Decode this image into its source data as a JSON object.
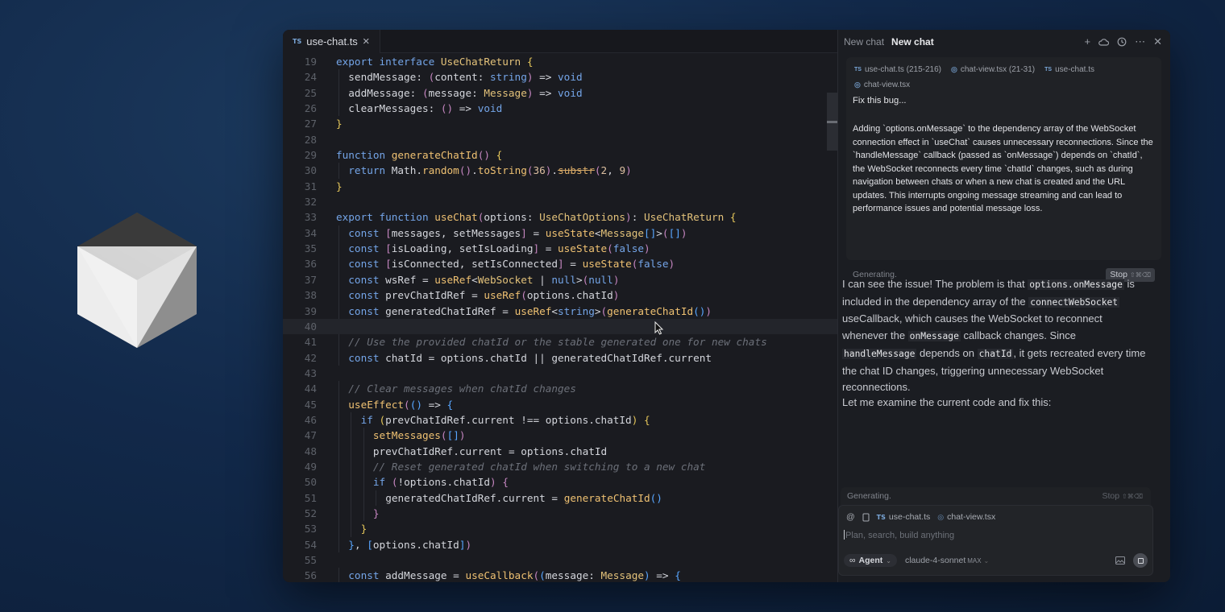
{
  "editor": {
    "tab": {
      "badge": "TS",
      "filename": "use-chat.ts",
      "close": "×"
    },
    "active_line": "40",
    "lines": [
      {
        "n": "19",
        "indent": 0,
        "segs": [
          [
            "k",
            "export interface "
          ],
          [
            "ty",
            "UseChatReturn "
          ],
          [
            "br",
            "{"
          ]
        ]
      },
      {
        "n": "24",
        "indent": 1,
        "segs": [
          [
            "pl",
            "sendMessage: "
          ],
          [
            "br2",
            "("
          ],
          [
            "pl",
            "content: "
          ],
          [
            "k",
            "string"
          ],
          [
            "br2",
            ")"
          ],
          [
            "pl",
            " => "
          ],
          [
            "k",
            "void"
          ]
        ]
      },
      {
        "n": "25",
        "indent": 1,
        "segs": [
          [
            "pl",
            "addMessage: "
          ],
          [
            "br2",
            "("
          ],
          [
            "pl",
            "message: "
          ],
          [
            "ty",
            "Message"
          ],
          [
            "br2",
            ")"
          ],
          [
            "pl",
            " => "
          ],
          [
            "k",
            "void"
          ]
        ]
      },
      {
        "n": "26",
        "indent": 1,
        "segs": [
          [
            "pl",
            "clearMessages: "
          ],
          [
            "br2",
            "()"
          ],
          [
            "pl",
            " => "
          ],
          [
            "k",
            "void"
          ]
        ]
      },
      {
        "n": "27",
        "indent": 0,
        "segs": [
          [
            "br",
            "}"
          ]
        ]
      },
      {
        "n": "28",
        "indent": 0,
        "segs": []
      },
      {
        "n": "29",
        "indent": 0,
        "segs": [
          [
            "k",
            "function "
          ],
          [
            "fn",
            "generateChatId"
          ],
          [
            "br2",
            "()"
          ],
          [
            "pl",
            " "
          ],
          [
            "br",
            "{"
          ]
        ]
      },
      {
        "n": "30",
        "indent": 1,
        "segs": [
          [
            "k",
            "return "
          ],
          [
            "pl",
            "Math."
          ],
          [
            "fn",
            "random"
          ],
          [
            "br2",
            "()"
          ],
          [
            "pl",
            "."
          ],
          [
            "fn",
            "toString"
          ],
          [
            "br2",
            "("
          ],
          [
            "num",
            "36"
          ],
          [
            "br2",
            ")"
          ],
          [
            "pl",
            "."
          ],
          [
            "strike",
            "substr"
          ],
          [
            "br2",
            "("
          ],
          [
            "num",
            "2"
          ],
          [
            "pl",
            ", "
          ],
          [
            "num",
            "9"
          ],
          [
            "br2",
            ")"
          ]
        ]
      },
      {
        "n": "31",
        "indent": 0,
        "segs": [
          [
            "br",
            "}"
          ]
        ]
      },
      {
        "n": "32",
        "indent": 0,
        "segs": []
      },
      {
        "n": "33",
        "indent": 0,
        "segs": [
          [
            "k",
            "export function "
          ],
          [
            "fn",
            "useChat"
          ],
          [
            "br2",
            "("
          ],
          [
            "pl",
            "options: "
          ],
          [
            "ty",
            "UseChatOptions"
          ],
          [
            "br2",
            ")"
          ],
          [
            "pl",
            ": "
          ],
          [
            "ty",
            "UseChatReturn "
          ],
          [
            "br",
            "{"
          ]
        ]
      },
      {
        "n": "34",
        "indent": 1,
        "segs": [
          [
            "k",
            "const "
          ],
          [
            "br2",
            "["
          ],
          [
            "pl",
            "messages, setMessages"
          ],
          [
            "br2",
            "]"
          ],
          [
            "pl",
            " = "
          ],
          [
            "fn",
            "useState"
          ],
          [
            "pl",
            "<"
          ],
          [
            "ty",
            "Message"
          ],
          [
            "br3",
            "[]"
          ],
          [
            "pl",
            ">"
          ],
          [
            "br2",
            "("
          ],
          [
            "br3",
            "[]"
          ],
          [
            "br2",
            ")"
          ]
        ]
      },
      {
        "n": "35",
        "indent": 1,
        "segs": [
          [
            "k",
            "const "
          ],
          [
            "br2",
            "["
          ],
          [
            "pl",
            "isLoading, setIsLoading"
          ],
          [
            "br2",
            "]"
          ],
          [
            "pl",
            " = "
          ],
          [
            "fn",
            "useState"
          ],
          [
            "br2",
            "("
          ],
          [
            "k",
            "false"
          ],
          [
            "br2",
            ")"
          ]
        ]
      },
      {
        "n": "36",
        "indent": 1,
        "segs": [
          [
            "k",
            "const "
          ],
          [
            "br2",
            "["
          ],
          [
            "pl",
            "isConnected, setIsConnected"
          ],
          [
            "br2",
            "]"
          ],
          [
            "pl",
            " = "
          ],
          [
            "fn",
            "useState"
          ],
          [
            "br2",
            "("
          ],
          [
            "k",
            "false"
          ],
          [
            "br2",
            ")"
          ]
        ]
      },
      {
        "n": "37",
        "indent": 1,
        "segs": [
          [
            "k",
            "const "
          ],
          [
            "pl",
            "wsRef = "
          ],
          [
            "fn",
            "useRef"
          ],
          [
            "pl",
            "<"
          ],
          [
            "ty",
            "WebSocket"
          ],
          [
            "pl",
            " | "
          ],
          [
            "k",
            "null"
          ],
          [
            "pl",
            ">"
          ],
          [
            "br2",
            "("
          ],
          [
            "k",
            "null"
          ],
          [
            "br2",
            ")"
          ]
        ]
      },
      {
        "n": "38",
        "indent": 1,
        "segs": [
          [
            "k",
            "const "
          ],
          [
            "pl",
            "prevChatIdRef = "
          ],
          [
            "fn",
            "useRef"
          ],
          [
            "br2",
            "("
          ],
          [
            "pl",
            "options.chatId"
          ],
          [
            "br2",
            ")"
          ]
        ]
      },
      {
        "n": "39",
        "indent": 1,
        "segs": [
          [
            "k",
            "const "
          ],
          [
            "pl",
            "generatedChatIdRef = "
          ],
          [
            "fn",
            "useRef"
          ],
          [
            "pl",
            "<"
          ],
          [
            "k",
            "string"
          ],
          [
            "pl",
            ">"
          ],
          [
            "br2",
            "("
          ],
          [
            "fn",
            "generateChatId"
          ],
          [
            "br3",
            "()"
          ],
          [
            "br2",
            ")"
          ]
        ]
      },
      {
        "n": "40",
        "indent": 0,
        "segs": []
      },
      {
        "n": "41",
        "indent": 1,
        "segs": [
          [
            "cm",
            "// Use the provided chatId or the stable generated one for new chats"
          ]
        ]
      },
      {
        "n": "42",
        "indent": 1,
        "segs": [
          [
            "k",
            "const "
          ],
          [
            "pl",
            "chatId = options.chatId || generatedChatIdRef.current"
          ]
        ]
      },
      {
        "n": "43",
        "indent": 0,
        "segs": []
      },
      {
        "n": "44",
        "indent": 1,
        "segs": [
          [
            "cm",
            "// Clear messages when chatId changes"
          ]
        ]
      },
      {
        "n": "45",
        "indent": 1,
        "segs": [
          [
            "fn",
            "useEffect"
          ],
          [
            "br2",
            "("
          ],
          [
            "br3",
            "()"
          ],
          [
            "pl",
            " => "
          ],
          [
            "br3",
            "{"
          ]
        ]
      },
      {
        "n": "46",
        "indent": 2,
        "segs": [
          [
            "k",
            "if "
          ],
          [
            "br",
            "("
          ],
          [
            "pl",
            "prevChatIdRef.current !== options.chatId"
          ],
          [
            "br",
            ")"
          ],
          [
            "pl",
            " "
          ],
          [
            "br",
            "{"
          ]
        ]
      },
      {
        "n": "47",
        "indent": 3,
        "segs": [
          [
            "fn",
            "setMessages"
          ],
          [
            "br2",
            "("
          ],
          [
            "br3",
            "[]"
          ],
          [
            "br2",
            ")"
          ]
        ]
      },
      {
        "n": "48",
        "indent": 3,
        "segs": [
          [
            "pl",
            "prevChatIdRef.current = options.chatId"
          ]
        ]
      },
      {
        "n": "49",
        "indent": 3,
        "segs": [
          [
            "cm",
            "// Reset generated chatId when switching to a new chat"
          ]
        ]
      },
      {
        "n": "50",
        "indent": 3,
        "segs": [
          [
            "k",
            "if "
          ],
          [
            "br2",
            "("
          ],
          [
            "pl",
            "!options.chatId"
          ],
          [
            "br2",
            ")"
          ],
          [
            "pl",
            " "
          ],
          [
            "br2",
            "{"
          ]
        ]
      },
      {
        "n": "51",
        "indent": 4,
        "segs": [
          [
            "pl",
            "generatedChatIdRef.current = "
          ],
          [
            "fn",
            "generateChatId"
          ],
          [
            "br3",
            "()"
          ]
        ]
      },
      {
        "n": "52",
        "indent": 3,
        "segs": [
          [
            "br2",
            "}"
          ]
        ]
      },
      {
        "n": "53",
        "indent": 2,
        "segs": [
          [
            "br",
            "}"
          ]
        ]
      },
      {
        "n": "54",
        "indent": 1,
        "segs": [
          [
            "br3",
            "}"
          ],
          [
            "pl",
            ", "
          ],
          [
            "br3",
            "["
          ],
          [
            "pl",
            "options.chatId"
          ],
          [
            "br3",
            "]"
          ],
          [
            "br2",
            ")"
          ]
        ]
      },
      {
        "n": "55",
        "indent": 0,
        "segs": []
      },
      {
        "n": "56",
        "indent": 1,
        "segs": [
          [
            "k",
            "const "
          ],
          [
            "pl",
            "addMessage = "
          ],
          [
            "fn",
            "useCallback"
          ],
          [
            "br2",
            "("
          ],
          [
            "br3",
            "("
          ],
          [
            "pl",
            "message: "
          ],
          [
            "ty",
            "Message"
          ],
          [
            "br3",
            ")"
          ],
          [
            "pl",
            " => "
          ],
          [
            "br3",
            "{"
          ]
        ]
      }
    ]
  },
  "chat": {
    "tabs": [
      "New chat",
      "New chat"
    ],
    "header_icons": [
      "plus-icon",
      "cloud-icon",
      "history-icon",
      "more-icon",
      "close-icon"
    ],
    "context_chips": [
      {
        "icon": "TS",
        "label": "use-chat.ts (215-216)"
      },
      {
        "icon": "◎",
        "label": "chat-view.tsx (21-31)"
      },
      {
        "icon": "TS",
        "label": "use-chat.ts"
      },
      {
        "icon": "◎",
        "label": "chat-view.tsx"
      }
    ],
    "user_message_title": "Fix this bug...",
    "user_message_body": "Adding `options.onMessage` to the dependency array of the WebSocket connection effect in `useChat` causes unnecessary reconnections. Since the `handleMessage` callback (passed as `onMessage`) depends on `chatId`, the WebSocket reconnects every time `chatId` changes, such as during navigation between chats or when a new chat is created and the URL updates. This interrupts ongoing message streaming and can lead to performance issues and potential message loss.",
    "status": "Generating.",
    "stop_label": "Stop",
    "stop_shortcut": "⇧⌘⌫",
    "reply": {
      "p1": "I can see the issue! The problem is that ",
      "c1": "options.onMessage",
      "p2": " is included in the dependency array of the ",
      "c2": "connectWebSocket",
      "p3": " useCallback, which causes the WebSocket to reconnect whenever the ",
      "c3": "onMessage",
      "p4": " callback changes. Since ",
      "c4": "handleMessage",
      "p5": " depends on ",
      "c5": "chatId",
      "p6": ", it gets recreated every time the chat ID changes, triggering unnecessary WebSocket reconnections."
    },
    "reply2": "Let me examine the current code and fix this:",
    "composer": {
      "status": "Generating.",
      "stop_label": "Stop",
      "stop_shortcut": "⇧⌘⌫",
      "chips": [
        "use-chat.ts",
        "chat-view.tsx"
      ],
      "placeholder": "Plan, search, build anything",
      "mode": "Agent",
      "model": "claude-4-sonnet",
      "model_badge": "MAX"
    }
  }
}
